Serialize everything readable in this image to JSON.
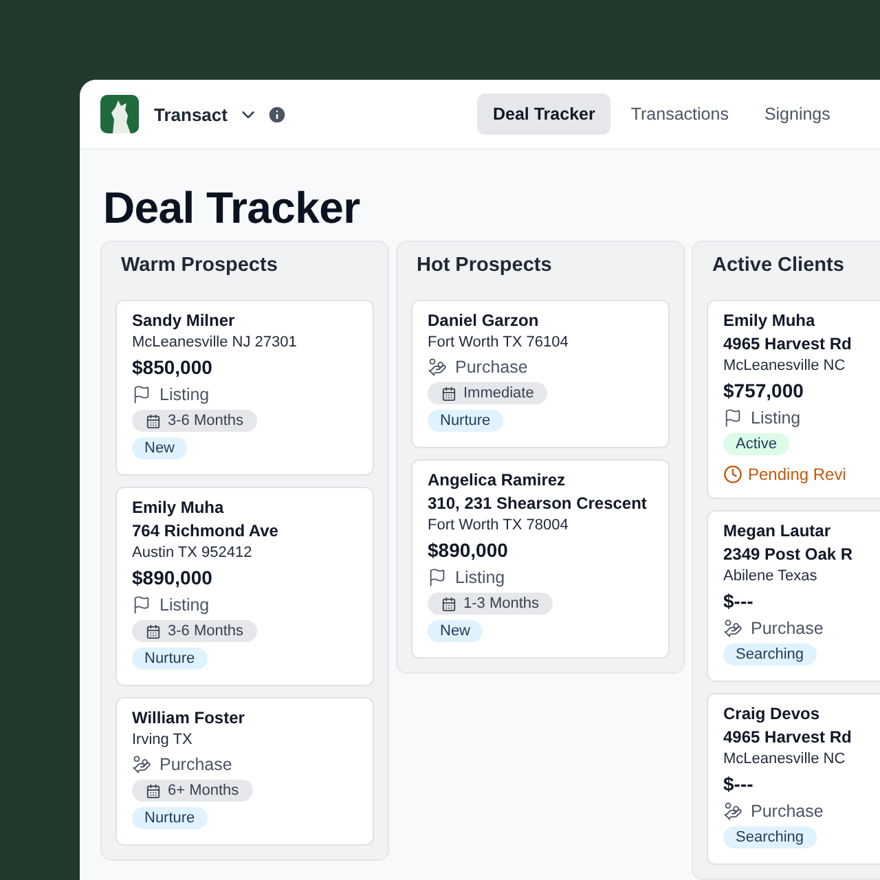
{
  "app": {
    "name": "Transact"
  },
  "nav": [
    {
      "label": "Deal Tracker",
      "selected": true
    },
    {
      "label": "Transactions",
      "selected": false
    },
    {
      "label": "Signings",
      "selected": false
    }
  ],
  "page_title": "Deal Tracker",
  "columns": [
    {
      "title": "Warm Prospects",
      "cards": [
        {
          "name": "Sandy Milner",
          "city": "McLeanesville NJ 27301",
          "price": "$850,000",
          "deal": {
            "kind": "listing",
            "label": "Listing"
          },
          "timeline": "3-6 Months",
          "tags": [
            {
              "label": "New",
              "color": "#e0f2fe"
            }
          ]
        },
        {
          "name": "Emily Muha",
          "address": "764 Richmond Ave",
          "city": "Austin TX 952412",
          "price": "$890,000",
          "deal": {
            "kind": "listing",
            "label": "Listing"
          },
          "timeline": "3-6 Months",
          "tags": [
            {
              "label": "Nurture",
              "color": "#e0f2fe"
            }
          ]
        },
        {
          "name": "William Foster",
          "city": "Irving TX",
          "deal": {
            "kind": "purchase",
            "label": "Purchase"
          },
          "timeline": "6+ Months",
          "tags": [
            {
              "label": "Nurture",
              "color": "#e0f2fe"
            }
          ]
        }
      ]
    },
    {
      "title": "Hot Prospects",
      "cards": [
        {
          "name": "Daniel Garzon",
          "city": "Fort Worth TX 76104",
          "deal": {
            "kind": "purchase",
            "label": "Purchase"
          },
          "timeline": "Immediate",
          "tags": [
            {
              "label": "Nurture",
              "color": "#e0f2fe"
            }
          ]
        },
        {
          "name": "Angelica Ramirez",
          "address": "310, 231 Shearson Crescent",
          "city": "Fort Worth TX 78004",
          "price": "$890,000",
          "deal": {
            "kind": "listing",
            "label": "Listing"
          },
          "timeline": "1-3 Months",
          "tags": [
            {
              "label": "New",
              "color": "#e0f2fe"
            }
          ]
        }
      ]
    },
    {
      "title": "Active Clients",
      "cards": [
        {
          "name": "Emily Muha",
          "address": "4965 Harvest Rd",
          "city": "McLeanesville NC",
          "price": "$757,000",
          "deal": {
            "kind": "listing",
            "label": "Listing"
          },
          "tags": [
            {
              "label": "Active",
              "color": "#dcfce7"
            }
          ],
          "pending": "Pending Revi"
        },
        {
          "name": "Megan Lautar",
          "address": "2349 Post Oak R",
          "city": "Abilene Texas",
          "price": "$---",
          "deal": {
            "kind": "purchase",
            "label": "Purchase"
          },
          "tags": [
            {
              "label": "Searching",
              "color": "#e0f2fe"
            }
          ]
        },
        {
          "name": "Craig Devos",
          "address": "4965 Harvest Rd",
          "city": "McLeanesville NC",
          "price": "$---",
          "deal": {
            "kind": "purchase",
            "label": "Purchase"
          },
          "tags": [
            {
              "label": "Searching",
              "color": "#e0f2fe"
            }
          ]
        }
      ]
    }
  ]
}
